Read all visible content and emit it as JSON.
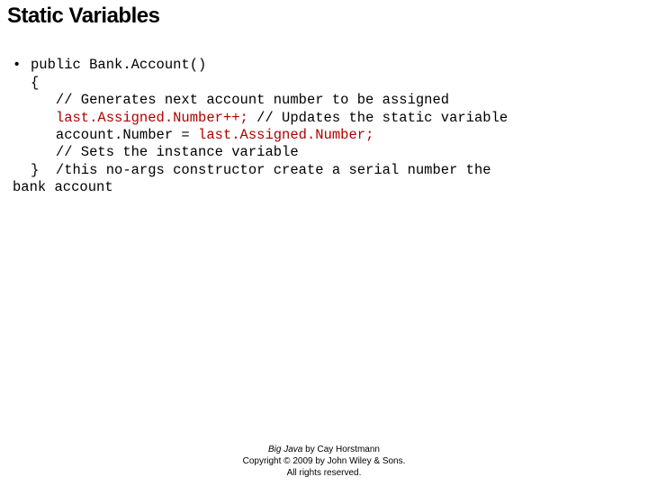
{
  "title": "Static Variables",
  "bullet_glyph": "•",
  "code": {
    "l1": "public Bank.Account()",
    "l2": "{",
    "l3": "   // Generates next account number to be assigned",
    "l4a": "   ",
    "l4_red": "last.Assigned.Number++;",
    "l4b": " // Updates the static variable",
    "l5a": "   account.Number = ",
    "l5_red": "last.Assigned.Number;",
    "l6": "   // Sets the instance variable",
    "l7": "}  /this no-args constructor create a serial number the",
    "l8": "bank account"
  },
  "footer": {
    "book_title": "Big Java",
    "by": " by Cay Horstmann",
    "line2": "Copyright © 2009 by John Wiley & Sons.",
    "line3": "All rights reserved."
  }
}
